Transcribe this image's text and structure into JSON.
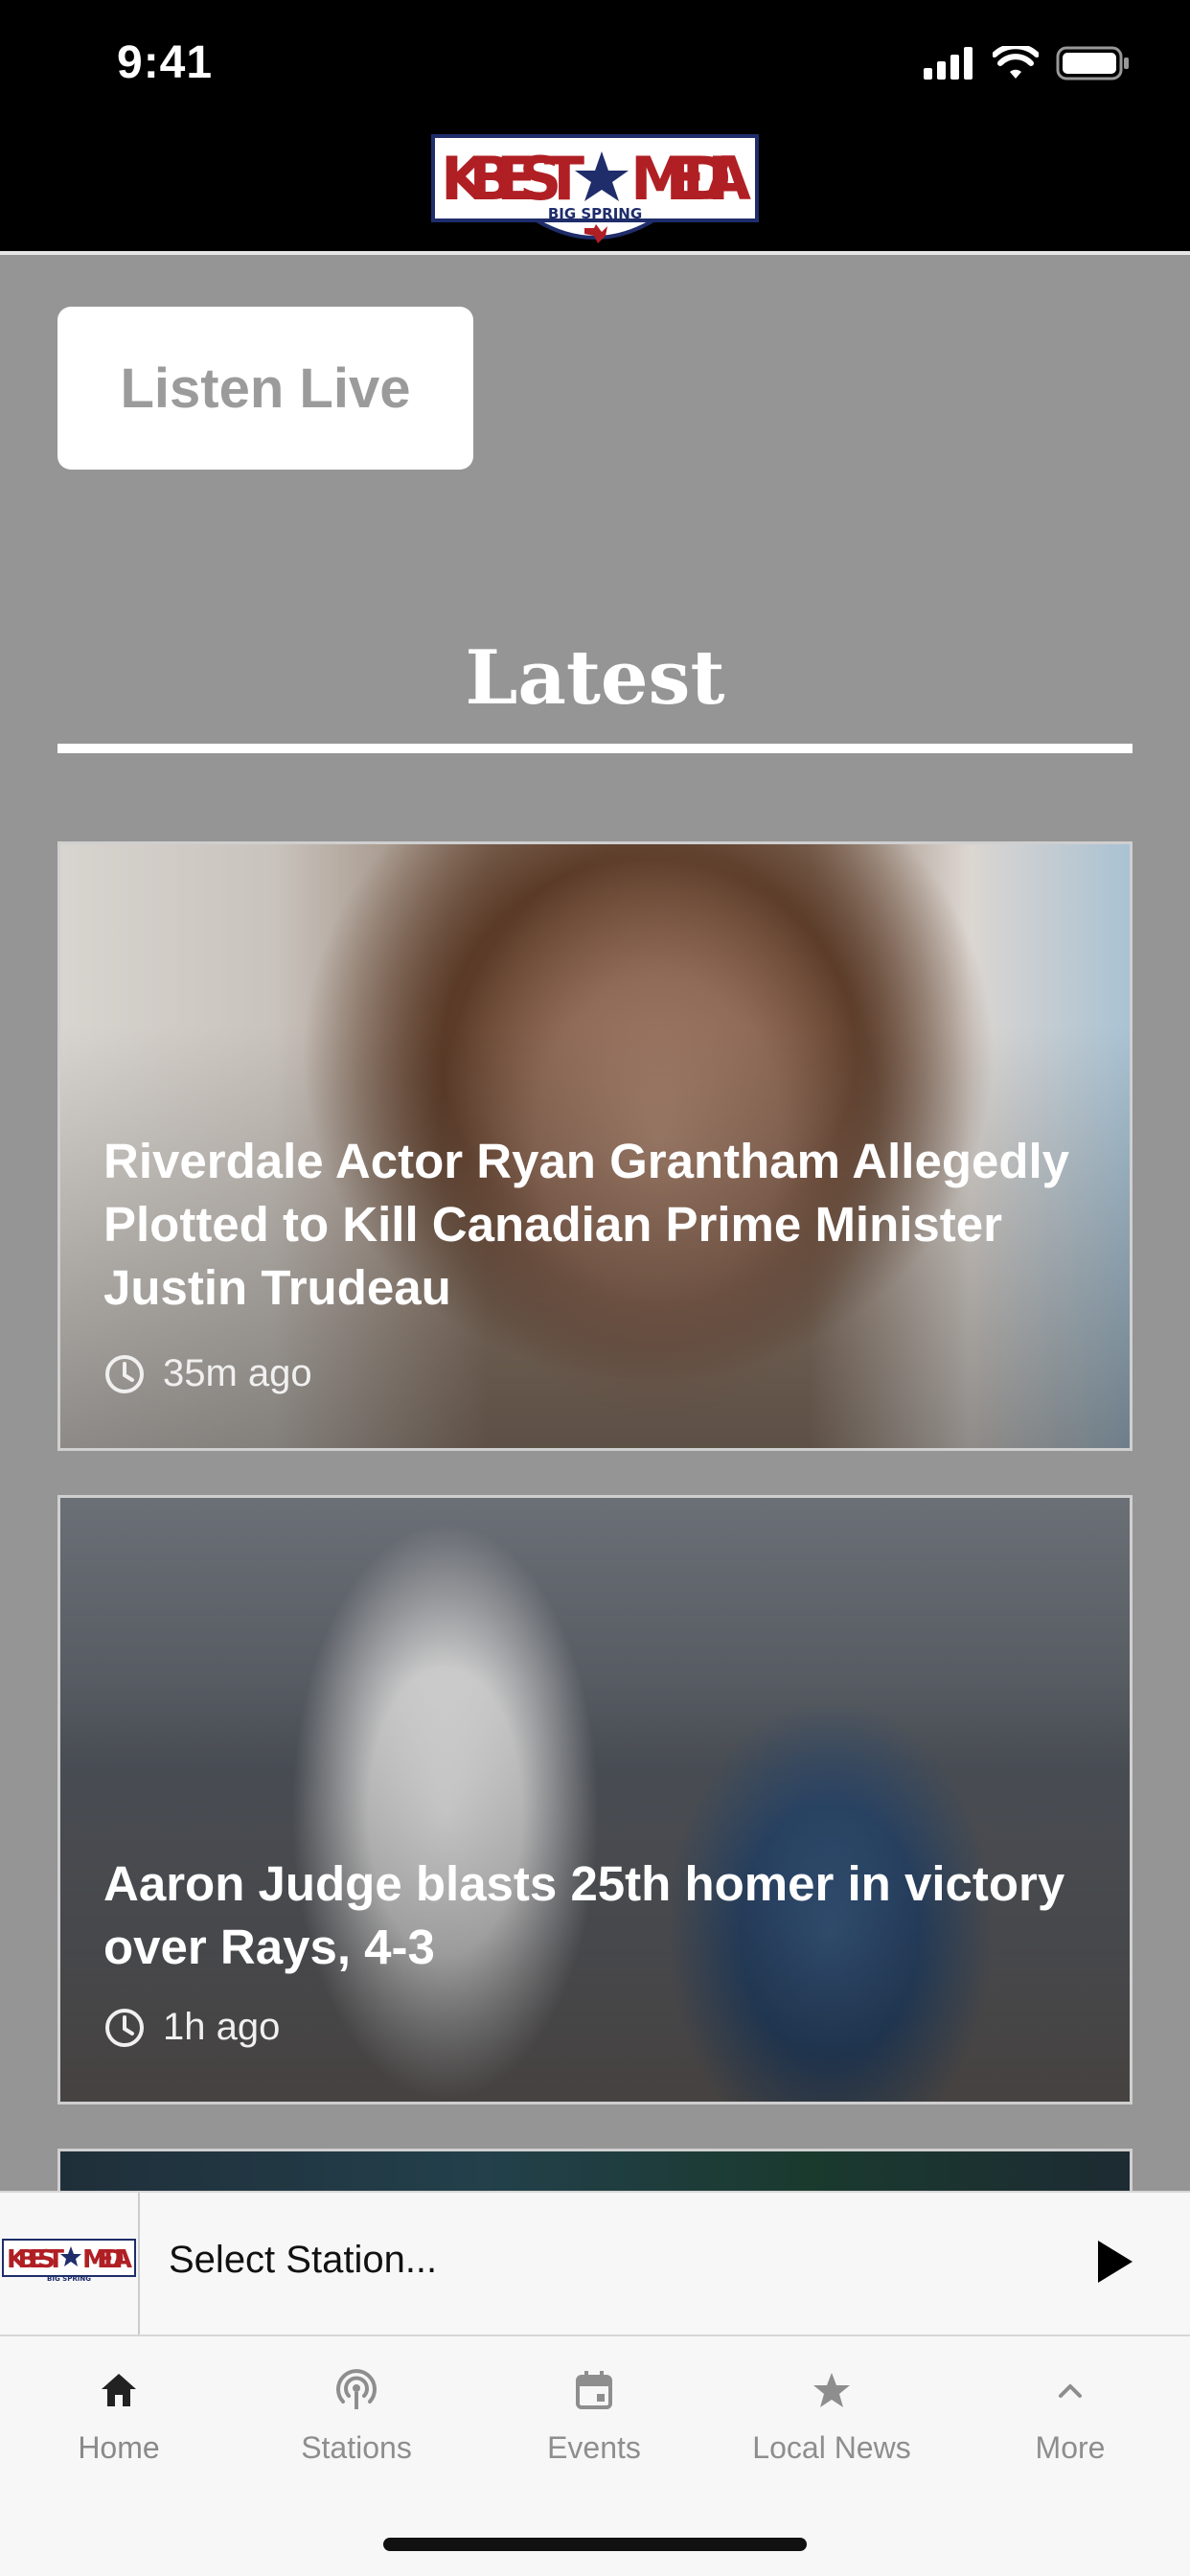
{
  "status_bar": {
    "time": "9:41"
  },
  "brand": {
    "logo_text_left": "KBEST",
    "logo_text_right": "MEDIA",
    "logo_sub": "BIG SPRING",
    "logo_star_color": "#1f2d6b",
    "logo_text_color": "#b01f24"
  },
  "listen_live": {
    "label": "Listen Live"
  },
  "section": {
    "title": "Latest"
  },
  "articles": [
    {
      "title": "Riverdale Actor Ryan Grantham Allegedly Plotted to Kill Canadian Prime Minister Justin Trudeau",
      "time": "35m ago"
    },
    {
      "title": "Aaron Judge blasts 25th homer in victory over Rays, 4-3",
      "time": "1h ago"
    }
  ],
  "player": {
    "station_placeholder": "Select Station..."
  },
  "tabs": [
    {
      "label": "Home",
      "icon": "home-icon"
    },
    {
      "label": "Stations",
      "icon": "broadcast-icon"
    },
    {
      "label": "Events",
      "icon": "calendar-icon"
    },
    {
      "label": "Local News",
      "icon": "star-icon"
    },
    {
      "label": "More",
      "icon": "chevron-up-icon"
    }
  ],
  "colors": {
    "page_bg": "#959595",
    "header_bg": "#000000",
    "tabbar_bg": "#f7f7f7"
  }
}
